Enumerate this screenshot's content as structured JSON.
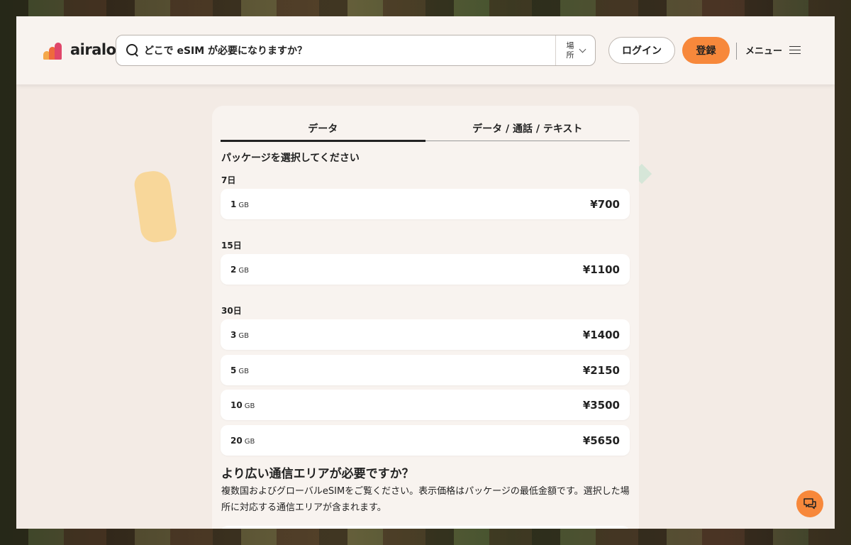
{
  "header": {
    "logo_text": "airalo",
    "search_placeholder": "どこで eSIM が必要になりますか？",
    "location_label": "場所",
    "login_label": "ログイン",
    "register_label": "登録",
    "menu_label": "メニュー"
  },
  "tabs": [
    {
      "label": "データ",
      "active": true
    },
    {
      "label": "データ / 通話 / テキスト",
      "active": false
    }
  ],
  "select_title": "パッケージを選択してください",
  "groups": [
    {
      "label": "7日",
      "packages": [
        {
          "amount": "1",
          "unit": "GB",
          "price": "¥700"
        }
      ]
    },
    {
      "label": "15日",
      "packages": [
        {
          "amount": "2",
          "unit": "GB",
          "price": "¥1100"
        }
      ]
    },
    {
      "label": "30日",
      "packages": [
        {
          "amount": "3",
          "unit": "GB",
          "price": "¥1400"
        },
        {
          "amount": "5",
          "unit": "GB",
          "price": "¥2150"
        },
        {
          "amount": "10",
          "unit": "GB",
          "price": "¥3500"
        },
        {
          "amount": "20",
          "unit": "GB",
          "price": "¥5650"
        }
      ]
    }
  ],
  "wide_area": {
    "title": "より広い通信エリアが必要ですか？",
    "description": "複数国およびグローバルeSIMをご覧ください。表示価格はパッケージの最低金額です。選択した場所に対応する通信エリアが含まれます。"
  },
  "colors": {
    "accent": "#f7883b",
    "background": "#f3ebe5"
  },
  "icons": {
    "search": "search-icon",
    "chevron": "chevron-down-icon",
    "menu": "hamburger-icon",
    "chat": "chat-icon"
  }
}
